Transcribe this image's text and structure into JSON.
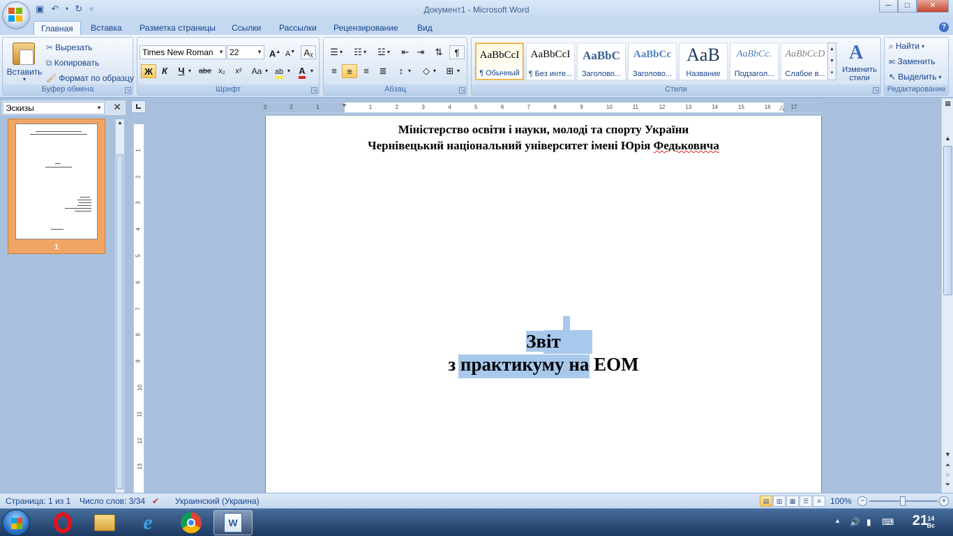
{
  "window": {
    "title": "Документ1 - Microsoft Word",
    "min": "─",
    "max": "□",
    "close": "✕"
  },
  "tabs": [
    "Главная",
    "Вставка",
    "Разметка страницы",
    "Ссылки",
    "Рассылки",
    "Рецензирование",
    "Вид"
  ],
  "clipboard": {
    "paste": "Вставить",
    "cut": "Вырезать",
    "copy": "Копировать",
    "format_painter": "Формат по образцу",
    "label": "Буфер обмена"
  },
  "font": {
    "name": "Times New Roman",
    "size": "22",
    "bold": "Ж",
    "italic": "К",
    "underline": "Ч",
    "strike": "abe",
    "sub": "x₂",
    "sup": "x²",
    "case": "Aa",
    "grow": "A",
    "shrink": "A",
    "label": "Шрифт"
  },
  "paragraph": {
    "label": "Абзац",
    "pilcrow": "¶"
  },
  "styles": {
    "label": "Стили",
    "items": [
      {
        "preview": "AaBbCcI",
        "name": "¶ Обычный"
      },
      {
        "preview": "AaBbCcI",
        "name": "¶ Без инте..."
      },
      {
        "preview": "AaBbC",
        "name": "Заголово..."
      },
      {
        "preview": "AaBbCc",
        "name": "Заголово..."
      },
      {
        "preview": "AaB",
        "name": "Название"
      },
      {
        "preview": "AaBbCc.",
        "name": "Подзагол..."
      },
      {
        "preview": "AaBbCcD",
        "name": "Слабое в..."
      }
    ],
    "change": "Изменить стили"
  },
  "editing": {
    "label": "Редактирование",
    "find": "Найти",
    "replace": "Заменить",
    "select": "Выделить"
  },
  "thumbnails": {
    "combo": "Эскизы",
    "close": "✕",
    "page_number": "1"
  },
  "document": {
    "line1": "Міністерство освіти і науки, молоді та спорту України",
    "line2_a": "Чернівецький національний університет імені Юрія ",
    "line2_b": "Федьковича",
    "title1": "Звіт",
    "title2_a": "з практикуму ",
    "title2_b": "на ЕОМ"
  },
  "status": {
    "page": "Страница: 1 из 1",
    "words": "Число слов: 3/34",
    "language": "Украинский (Украина)",
    "zoom": "100%"
  },
  "taskbar": {
    "apps": [
      "Opera",
      "Проводник",
      "Internet Explorer",
      "Google Chrome",
      "Microsoft Word"
    ],
    "clock_hour": "21",
    "clock_min": "14",
    "clock_day": "Вс"
  },
  "colors": {
    "accent": "#15428b",
    "selection": "#a8c8ec",
    "active_style": "#f2b44c"
  }
}
